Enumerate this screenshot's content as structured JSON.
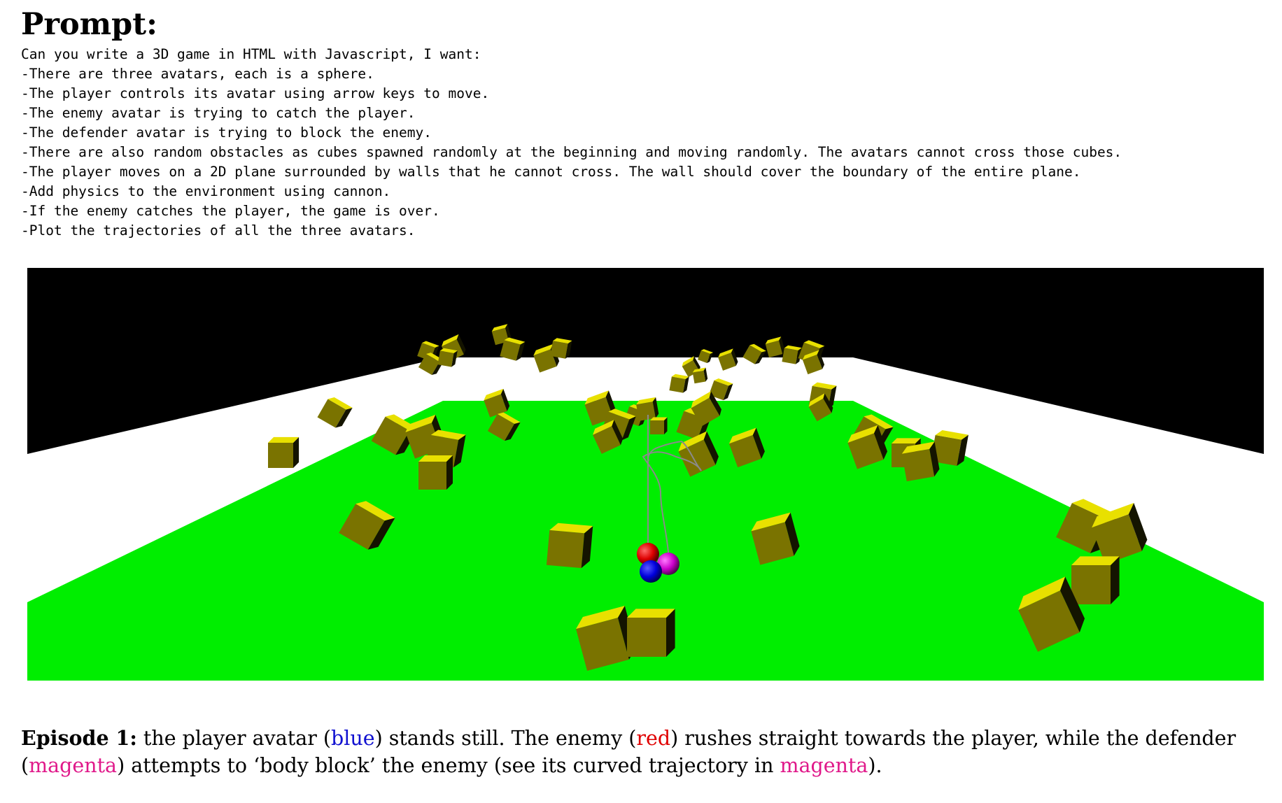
{
  "prompt": {
    "title": "Prompt:",
    "lines": [
      "Can you write a 3D game in HTML with Javascript, I want:",
      "-There are three avatars, each is a sphere.",
      "-The player controls its avatar using arrow keys to move.",
      "-The enemy avatar is trying to catch the player.",
      "-The defender avatar is trying to block the enemy.",
      "-There are also random obstacles as cubes spawned randomly at the beginning and moving randomly. The avatars cannot cross those cubes.",
      "-The player moves on a 2D plane surrounded by walls that he cannot cross. The wall should cover the boundary of the entire plane.",
      "-Add physics to the environment using cannon.",
      "-If the enemy catches the player, the game is over.",
      "-Plot the trajectories of all the three avatars."
    ]
  },
  "scene": {
    "colors": {
      "sky": "#000000",
      "wall": "#ffffff",
      "floor": "#00ee00",
      "cube_top": "#e8e000",
      "cube_side": "#7a7300",
      "cube_dark": "#141400",
      "player": "#0000ee",
      "enemy": "#ee0000",
      "defender": "#dd00dd",
      "trajectory": "#888888"
    },
    "avatars": [
      {
        "role": "player",
        "color_name": "blue"
      },
      {
        "role": "enemy",
        "color_name": "red"
      },
      {
        "role": "defender",
        "color_name": "magenta"
      }
    ],
    "obstacles": "cube-icon"
  },
  "caption": {
    "label": "Episode 1:",
    "t1": " the player avatar (",
    "w_blue": "blue",
    "t2": ") stands still.  The enemy (",
    "w_red": "red",
    "t3": ") rushes straight towards the player, while the defender (",
    "w_magenta1": "magenta",
    "t4": ") attempts to ‘body block’ the enemy (see its curved trajectory in ",
    "w_magenta2": "magenta",
    "t5": ")."
  }
}
